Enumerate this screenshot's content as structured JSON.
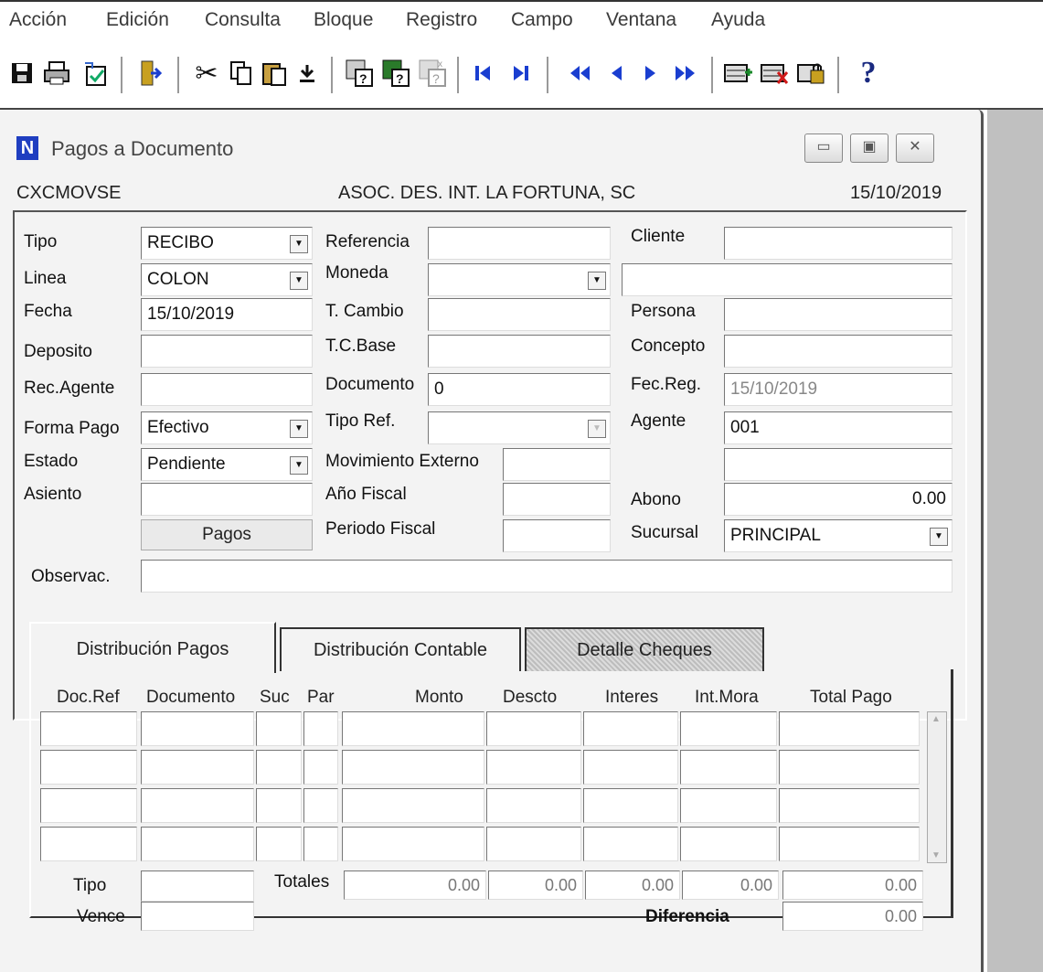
{
  "menu": [
    "Acción",
    "Edición",
    "Consulta",
    "Bloque",
    "Registro",
    "Campo",
    "Ventana",
    "Ayuda"
  ],
  "toolbar_icons": [
    "save-icon",
    "print-icon",
    "checklist-icon",
    "exit-icon",
    "cut-icon",
    "copy-icon",
    "paste-icon",
    "download-icon",
    "query-icon",
    "query-run-icon",
    "query-cancel-icon",
    "first-record-icon",
    "last-record-icon",
    "prev-block-icon",
    "prev-record-icon",
    "next-record-icon",
    "next-block-icon",
    "insert-record-icon",
    "delete-record-icon",
    "lock-record-icon",
    "help-icon"
  ],
  "window": {
    "title": "Pagos a Documento",
    "app_icon": "N",
    "form_code": "CXCMOVSE",
    "company": "ASOC. DES. INT. LA FORTUNA, SC",
    "date": "15/10/2019"
  },
  "form": {
    "tipo": {
      "label": "Tipo",
      "value": "RECIBO"
    },
    "linea": {
      "label": "Linea",
      "value": "COLON"
    },
    "fecha": {
      "label": "Fecha",
      "value": "15/10/2019"
    },
    "deposito": {
      "label": "Deposito",
      "value": ""
    },
    "rec_agente": {
      "label": "Rec.Agente",
      "value": ""
    },
    "forma_pago": {
      "label": "Forma Pago",
      "value": "Efectivo"
    },
    "estado": {
      "label": "Estado",
      "value": "Pendiente"
    },
    "asiento": {
      "label": "Asiento",
      "value": ""
    },
    "pagos_button": "Pagos",
    "referencia": {
      "label": "Referencia",
      "value": ""
    },
    "moneda": {
      "label": "Moneda",
      "value": ""
    },
    "t_cambio": {
      "label": "T. Cambio",
      "value": ""
    },
    "tc_base": {
      "label": "T.C.Base",
      "value": ""
    },
    "documento": {
      "label": "Documento",
      "value": "0"
    },
    "tipo_ref": {
      "label": "Tipo Ref.",
      "value": ""
    },
    "mov_externo": {
      "label": "Movimiento Externo",
      "value": ""
    },
    "anio_fiscal": {
      "label": "Año Fiscal",
      "value": ""
    },
    "periodo_fiscal": {
      "label": "Periodo Fiscal",
      "value": ""
    },
    "cliente": {
      "label": "Cliente",
      "value": "",
      "name": ""
    },
    "persona": {
      "label": "Persona",
      "value": ""
    },
    "concepto": {
      "label": "Concepto",
      "value": ""
    },
    "fec_reg": {
      "label": "Fec.Reg.",
      "value": "15/10/2019"
    },
    "agente": {
      "label": "Agente",
      "value": "001",
      "extra": ""
    },
    "abono": {
      "label": "Abono",
      "value": "0.00"
    },
    "sucursal": {
      "label": "Sucursal",
      "value": "PRINCIPAL"
    },
    "observac": {
      "label": "Observac.",
      "value": ""
    }
  },
  "tabs": [
    "Distribución Pagos",
    "Distribución Contable",
    "Detalle Cheques"
  ],
  "grid": {
    "columns": [
      "Doc.Ref",
      "Documento",
      "Suc",
      "Par",
      "Monto",
      "Descto",
      "Interes",
      "Int.Mora",
      "Total Pago"
    ],
    "rows": [
      [
        "",
        "",
        "",
        "",
        "",
        "",
        "",
        "",
        ""
      ],
      [
        "",
        "",
        "",
        "",
        "",
        "",
        "",
        "",
        ""
      ],
      [
        "",
        "",
        "",
        "",
        "",
        "",
        "",
        "",
        ""
      ],
      [
        "",
        "",
        "",
        "",
        "",
        "",
        "",
        "",
        ""
      ]
    ],
    "tipo_label": "Tipo",
    "vence_label": "Vence",
    "totales_label": "Totales",
    "totals": [
      "0.00",
      "0.00",
      "0.00",
      "0.00",
      "0.00"
    ],
    "diferencia_label": "Diferencia",
    "diferencia": "0.00"
  }
}
